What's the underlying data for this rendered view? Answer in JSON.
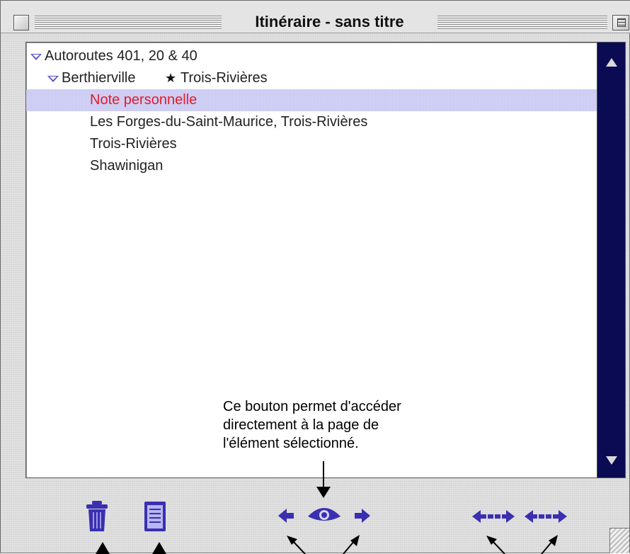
{
  "window": {
    "title": "Itinéraire - sans titre"
  },
  "list": {
    "rows": [
      {
        "label": "Autoroutes 401, 20 & 40",
        "level": 0,
        "disclosure": "expanded"
      },
      {
        "label": "Berthierville",
        "label_after_star": "Trois-Rivières",
        "level": 1,
        "disclosure": "expanded"
      },
      {
        "label": "Note personnelle",
        "level": 2,
        "selected": true
      },
      {
        "label": "Les Forges-du-Saint-Maurice, Trois-Rivières",
        "level": 2
      },
      {
        "label": "Trois-Rivières",
        "level": 2
      },
      {
        "label": "Shawinigan",
        "level": 2
      }
    ],
    "star_glyph": "★"
  },
  "annotation": {
    "lines": [
      "Ce bouton permet d'accéder",
      "directement à la page de",
      "l'élément sélectionné."
    ]
  },
  "toolbar": {
    "buttons": [
      {
        "name": "trash-icon",
        "icon": "trash"
      },
      {
        "name": "notepad-icon",
        "icon": "notepad"
      },
      {
        "name": "previous-arrow-icon",
        "icon": "arrow-left"
      },
      {
        "name": "eye-icon",
        "icon": "eye"
      },
      {
        "name": "next-arrow-icon",
        "icon": "arrow-right"
      },
      {
        "name": "move-left-icon",
        "icon": "double-arrow-left"
      },
      {
        "name": "move-right-icon",
        "icon": "double-arrow-right"
      }
    ]
  },
  "colors": {
    "accent": "#3a2fb0",
    "selection": "#c9c8f2",
    "selected_text": "#e31c2c",
    "scrollbar": "#0a0b52"
  }
}
